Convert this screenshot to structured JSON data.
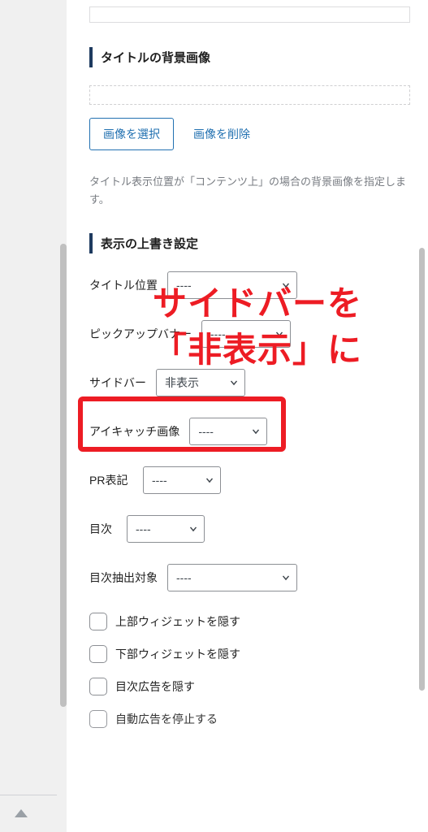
{
  "sections": {
    "bg_image": {
      "heading": "タイトルの背景画像",
      "select_image_btn": "画像を選択",
      "delete_image_link": "画像を削除",
      "description": "タイトル表示位置が「コンテンツ上」の場合の背景画像を指定します。"
    },
    "override": {
      "heading": "表示の上書き設定",
      "fields": {
        "title_position": {
          "label": "タイトル位置",
          "value": "----"
        },
        "pickup_banner": {
          "label": "ピックアップバナー",
          "value": "----"
        },
        "sidebar": {
          "label": "サイドバー",
          "value": "非表示"
        },
        "eyecatch": {
          "label": "アイキャッチ画像",
          "value": "----"
        },
        "pr": {
          "label": "PR表記",
          "value": "----"
        },
        "toc": {
          "label": "目次",
          "value": "----"
        },
        "toc_extract": {
          "label": "目次抽出対象",
          "value": "----"
        }
      },
      "checks": {
        "hide_top_widget": "上部ウィジェットを隠す",
        "hide_bottom_widget": "下部ウィジェットを隠す",
        "hide_toc_ads": "目次広告を隠す",
        "stop_auto_ads": "自動広告を停止する"
      }
    }
  },
  "annotation": {
    "line1": "サイドバーを",
    "line2": "「非表示」に"
  }
}
